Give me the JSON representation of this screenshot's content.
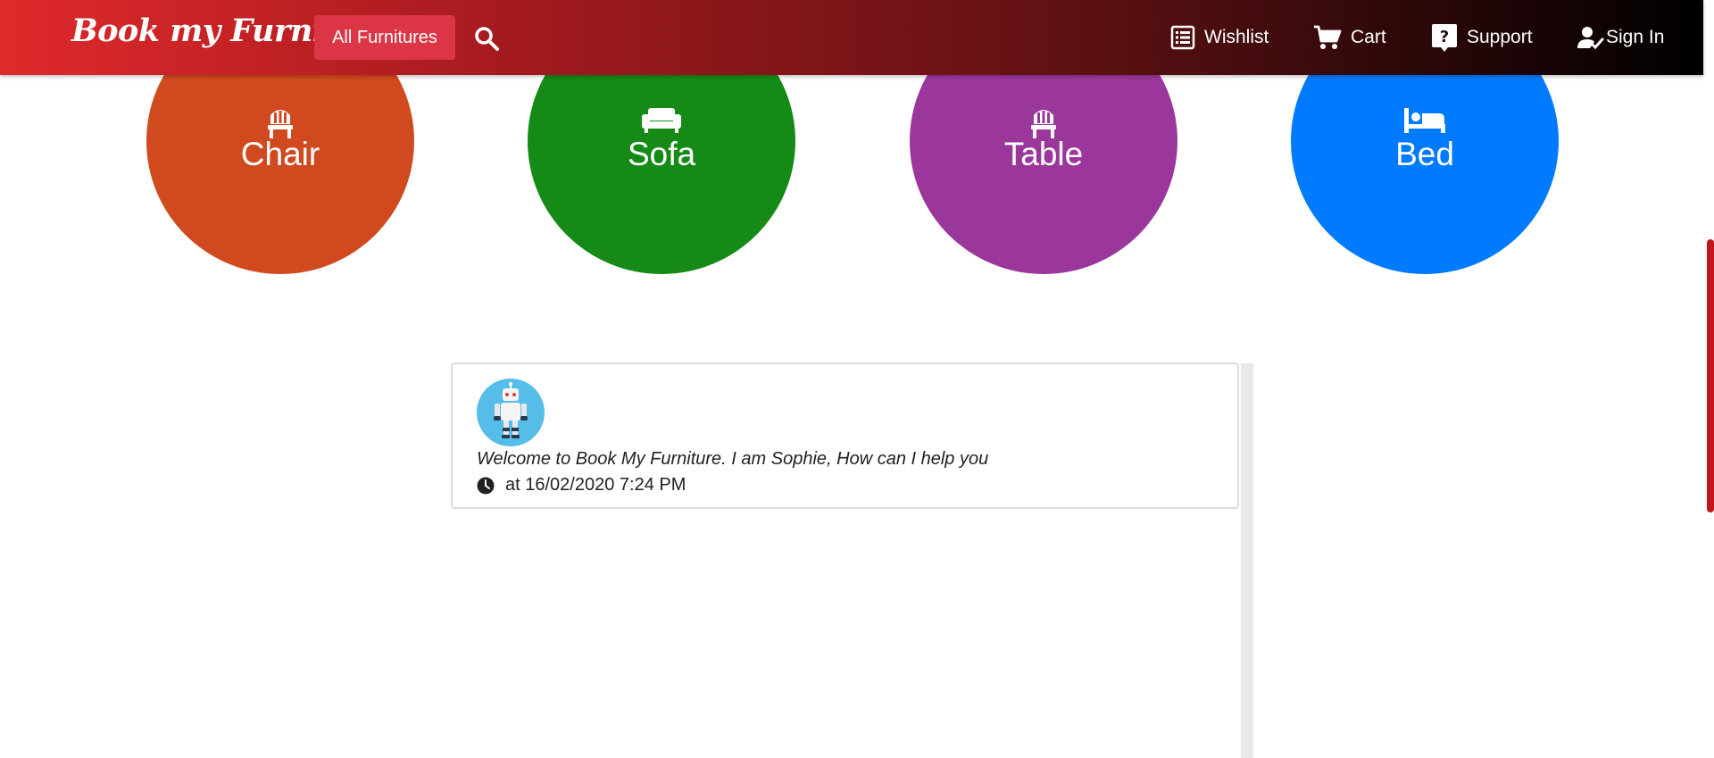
{
  "header": {
    "logo": "Book my Furniture",
    "all_button": "All Furnitures",
    "nav": {
      "wishlist": "Wishlist",
      "cart": "Cart",
      "support": "Support",
      "signin": "Sign In"
    }
  },
  "categories": [
    {
      "label": "Chair",
      "icon": "chair-icon",
      "color": "#d14a1f"
    },
    {
      "label": "Sofa",
      "icon": "sofa-icon",
      "color": "#168a17"
    },
    {
      "label": "Table",
      "icon": "chair-icon",
      "color": "#9b379b"
    },
    {
      "label": "Bed",
      "icon": "bed-icon",
      "color": "#007bff"
    }
  ],
  "chat": {
    "message": "Welcome to Book My Furniture. I am Sophie, How can I help you",
    "timestamp": "at 16/02/2020 7:24 PM",
    "avatar_icon": "robot-icon"
  },
  "colors": {
    "header_start": "#e0292b",
    "header_end": "#000000",
    "accent_button": "#dc3545",
    "scrollbar": "#c0161c"
  }
}
